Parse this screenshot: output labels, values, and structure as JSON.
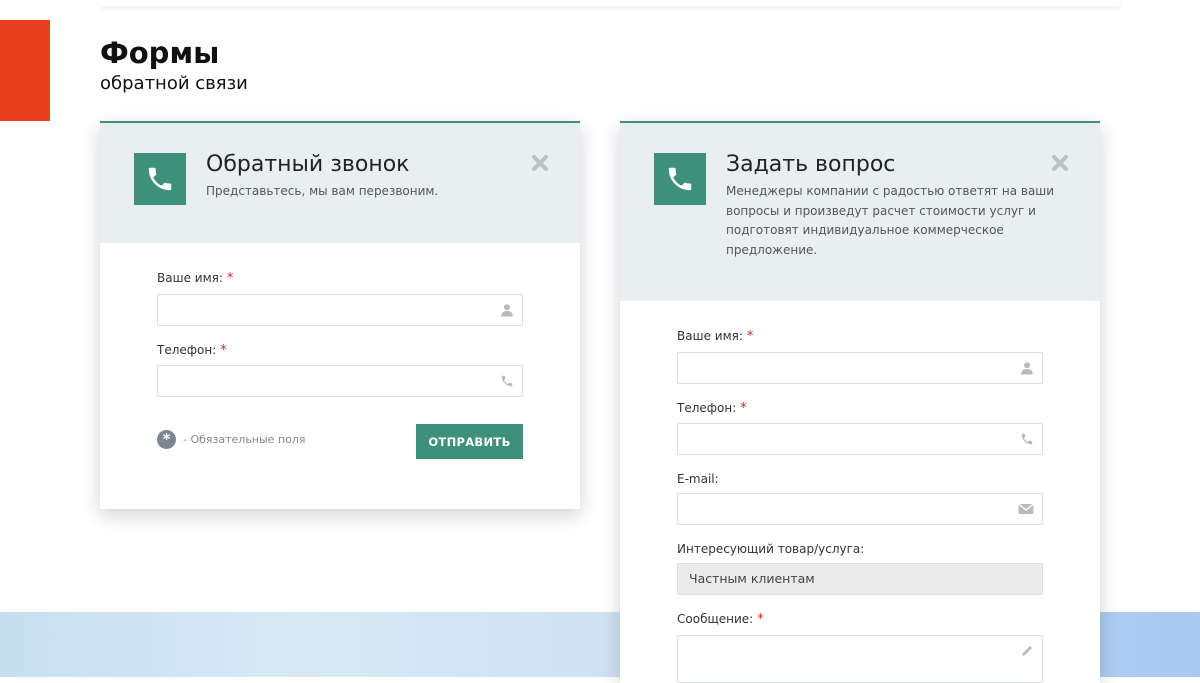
{
  "page": {
    "title": "Формы",
    "subtitle": "обратной связи"
  },
  "callback_form": {
    "title": "Обратный звонок",
    "description": "Представьтесь, мы вам перезвоним.",
    "fields": {
      "name_label": "Ваше имя:",
      "phone_label": "Телефон:"
    },
    "required_mark": "*",
    "required_note": "- Обязательные поля",
    "submit_label": "ОТПРАВИТЬ"
  },
  "question_form": {
    "title": "Задать вопрос",
    "description_lines": [
      "Менеджеры компании с радостью ответят на ваши",
      "вопросы и произведут расчет стоимости услуг и",
      "подготовят индивидуальное коммерческое",
      "предложение."
    ],
    "fields": {
      "name_label": "Ваше имя:",
      "phone_label": "Телефон:",
      "email_label": "E-mail:",
      "product_label": "Интересующий товар/услуга:",
      "product_value": "Частным клиентам",
      "message_label": "Сообщение:"
    },
    "required_mark": "*"
  },
  "colors": {
    "accent_orange": "#e8401c",
    "brand_green": "#3d907a",
    "header_bg": "#e9eff0"
  },
  "icons": [
    "phone-icon",
    "close-icon",
    "user-icon",
    "phone-small-icon",
    "envelope-icon",
    "pencil-icon",
    "asterisk-icon"
  ]
}
